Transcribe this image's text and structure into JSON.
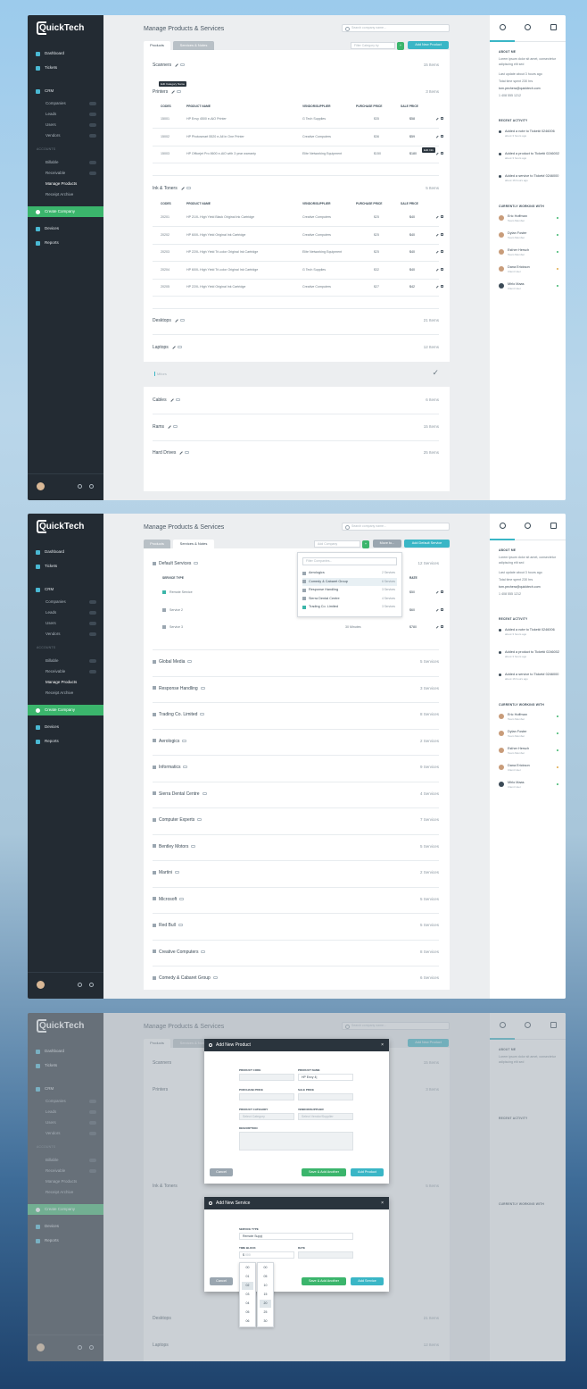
{
  "app": {
    "logo": "QuickTech",
    "logo_initial": "Q",
    "logo_rest": "uickTech"
  },
  "sidebar": {
    "items": [
      {
        "label": "Dashboard"
      },
      {
        "label": "Tickets"
      },
      {
        "label": "CRM"
      }
    ],
    "crm_sub": [
      {
        "label": "Companies",
        "badge": "422"
      },
      {
        "label": "Leads",
        "badge": "6"
      },
      {
        "label": "Users",
        "badge": "136"
      },
      {
        "label": "Vendors",
        "badge": "36"
      }
    ],
    "accounts_header": "ACCOUNTS",
    "accounts": [
      {
        "label": "Billable",
        "badge": "18"
      },
      {
        "label": "Receivable",
        "badge": "4"
      },
      {
        "label": "Manage Products"
      },
      {
        "label": "Receipt Archive"
      }
    ],
    "create_company": "Create Company",
    "devices": "Devices",
    "reports": "Reports"
  },
  "header": {
    "title": "Manage Products & Services",
    "search_placeholder": "Search company name..."
  },
  "tabs": {
    "products": "Products",
    "services": "Services & Notes"
  },
  "screen1": {
    "filter_placeholder": "Filter Category by",
    "add_button": "Add New Product",
    "tooltip_category": "Edit Category Name",
    "tooltip_edit": "Edit Info",
    "groups": [
      {
        "name": "Scanners",
        "count": "15 Items"
      },
      {
        "name": "Printers",
        "count": "3 Items"
      },
      {
        "name": "Ink & Toners",
        "count": "5 Items"
      },
      {
        "name": "Desktops",
        "count": "21 Items"
      },
      {
        "name": "Laptops",
        "count": "12 Items"
      },
      {
        "name": "Cables",
        "count": "6 Items"
      },
      {
        "name": "Rams",
        "count": "15 Items"
      },
      {
        "name": "Hard Drives",
        "count": "25 Items"
      }
    ],
    "new_category_placeholder": "Mitors",
    "columns": [
      "CODES",
      "PRODUCT NAME",
      "VENDOR/SUPPLIER",
      "PURCHASE PRICE",
      "SALE PRICE"
    ],
    "printers": [
      {
        "code": "15001",
        "name": "HP Envy 4500 e-AiO Printer",
        "vendor": "G Tech Supplies",
        "purchase": "$35",
        "sale": "$58"
      },
      {
        "code": "15002",
        "name": "HP Photosmart 5520 e-All in One Printer",
        "vendor": "Creative Computers",
        "purchase": "$36",
        "sale": "$59"
      },
      {
        "code": "15003",
        "name": "HP Officejet Pro 8600 e-AiO with 3 year warranty",
        "vendor": "Elite Networking Equipment",
        "purchase": "$150",
        "sale": "$180"
      }
    ],
    "inks": [
      {
        "code": "20201",
        "name": "HP 21XL High Yield Black Original Ink Cartridge",
        "vendor": "Creative Computers",
        "purchase": "$25",
        "sale": "$40"
      },
      {
        "code": "20202",
        "name": "HP 60XL High Yield Original Ink Cartridge",
        "vendor": "Creative Computers",
        "purchase": "$25",
        "sale": "$40"
      },
      {
        "code": "20203",
        "name": "HP 22XL High Yield Tri-color Original Ink Cartridge",
        "vendor": "Elite Networking Equipment",
        "purchase": "$25",
        "sale": "$40"
      },
      {
        "code": "20204",
        "name": "HP 60XL High Yield Tri-color Original Ink Cartridge",
        "vendor": "G Tech Supplies",
        "purchase": "$32",
        "sale": "$40"
      },
      {
        "code": "20205",
        "name": "HP 22XL High Yield Original Ink Cartridge",
        "vendor": "Creative Computers",
        "purchase": "$27",
        "sale": "$42"
      }
    ]
  },
  "screen2": {
    "add_company_placeholder": "Add Company",
    "move_to": "Move to...",
    "add_button": "Add Default Service",
    "filter_placeholder": "Filter Companies...",
    "default_group": {
      "name": "Default Services",
      "count": "12 Services"
    },
    "columns": [
      "SERVICE TYPE",
      "RATE"
    ],
    "services": [
      {
        "name": "Remote Service",
        "rate": "$50"
      },
      {
        "name": "Service 2",
        "rate": "$60"
      },
      {
        "name": "Service 3",
        "duration": "30 Minutes",
        "rate": "$780"
      }
    ],
    "dropdown": [
      {
        "name": "Aerologics",
        "count": "2 Services"
      },
      {
        "name": "Comedy & Cabaret Group",
        "count": "6 Services"
      },
      {
        "name": "Response Handling",
        "count": "3 Services"
      },
      {
        "name": "Sierra Dental Centre",
        "count": "4 Services"
      },
      {
        "name": "Trading Co. Limited",
        "count": "3 Services"
      }
    ],
    "groups": [
      {
        "name": "Global Media",
        "count": "5 Services"
      },
      {
        "name": "Response Handling",
        "count": "3 Services"
      },
      {
        "name": "Trading Co. Limited",
        "count": "8 Services"
      },
      {
        "name": "Aerologics",
        "count": "2 Services"
      },
      {
        "name": "Informatics",
        "count": "9 Services"
      },
      {
        "name": "Sierra Dental Centre",
        "count": "4 Services"
      },
      {
        "name": "Computer Experts",
        "count": "7 Services"
      },
      {
        "name": "Bentley Motors",
        "count": "5 Services"
      },
      {
        "name": "Martini",
        "count": "2 Services"
      },
      {
        "name": "Microsoft",
        "count": "5 Services"
      },
      {
        "name": "Red Bull",
        "count": "5 Services"
      },
      {
        "name": "Creative Computers",
        "count": "8 Services"
      },
      {
        "name": "Comedy & Cabaret Group",
        "count": "6 Services"
      }
    ]
  },
  "modal_product": {
    "title": "Add New Product",
    "labels": [
      "PRODUCT CODE",
      "PRODUCT NAME",
      "PURCHASE PRICE",
      "SALE PRICE",
      "PRODUCT CATEGORY",
      "VENDOR/SUPPLIER",
      "DESCRIPTION"
    ],
    "product_name_value": "HP Envy 4|",
    "category_placeholder": "Select Category",
    "vendor_placeholder": "Select Vendor/Supplier",
    "cancel": "Cancel",
    "save_another": "Save & Add Another",
    "add": "Add Product"
  },
  "modal_service": {
    "title": "Add New Service",
    "labels": [
      "SERVICE TYPE",
      "TIME BLOCK",
      "RATE"
    ],
    "service_value": "Remote Supp|",
    "time_value": "$",
    "time_placeholder": "000",
    "cancel": "Cancel",
    "save_another": "Save & Add Another",
    "add": "Add Service",
    "hours": [
      "00",
      "01",
      "02",
      "03",
      "04",
      "05",
      "06"
    ],
    "minutes": [
      "00",
      "05",
      "10",
      "15",
      "20",
      "25",
      "30"
    ]
  },
  "right_panel": {
    "about_header": "ABOUT ME",
    "about_text": "Lorem ipsum dolor sit amet, consectetur adipiscing elit sed",
    "about_items": [
      "Last update about 3 hours ago",
      "Total time spent 230 hrs",
      "tom.pechera@quicktech.com",
      "1 408 555 1212"
    ],
    "activity_header": "RECENT ACTIVITY",
    "activity": [
      {
        "text": "Added a note to Ticket# 0246006",
        "time": "about 3 hours ago"
      },
      {
        "text": "Added a product to Ticket# 0246002",
        "time": "about 3 hours ago"
      },
      {
        "text": "Added a service to Ticket# 0246000",
        "time": "about 16 hours ago"
      }
    ],
    "team_header": "CURRENTLY WORKING WITH",
    "team": [
      {
        "name": "Eric Hoffman",
        "role": "Team Member",
        "status": "online"
      },
      {
        "name": "Dylan Foster",
        "role": "Team Member",
        "status": "online"
      },
      {
        "name": "Esther Hersch",
        "role": "Team Member",
        "status": "online"
      },
      {
        "name": "Dana Erickson",
        "role": "Client User",
        "status": "away"
      },
      {
        "name": "Mirlo Maas",
        "role": "Client User",
        "status": "online"
      }
    ]
  },
  "colors": {
    "sidebar": "#232b33",
    "accent": "#3ab6c6",
    "green": "#3bb56c"
  }
}
